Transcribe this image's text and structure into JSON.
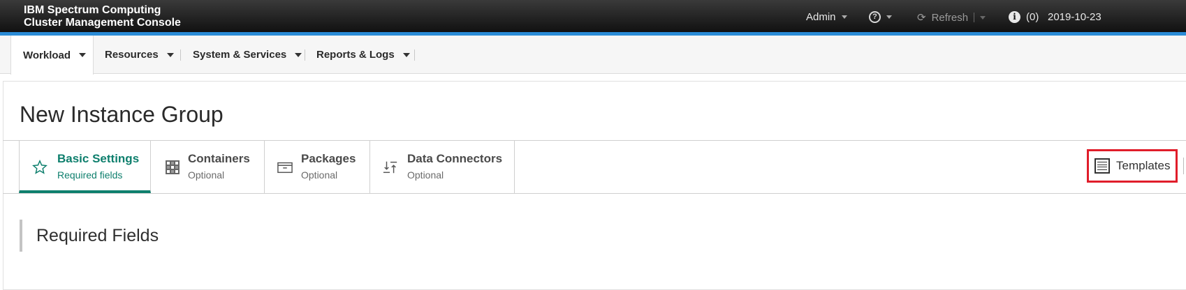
{
  "header": {
    "brand_line1": "IBM Spectrum Computing",
    "brand_line2": "Cluster Management Console",
    "user": "Admin",
    "help_icon": "question-circle-icon",
    "refresh": "Refresh",
    "info_count": "(0)",
    "datetime": "2019-10-23"
  },
  "nav": {
    "items": [
      {
        "label": "Workload"
      },
      {
        "label": "Resources"
      },
      {
        "label": "System & Services"
      },
      {
        "label": "Reports & Logs"
      }
    ]
  },
  "page": {
    "title": "New Instance Group"
  },
  "tabs": [
    {
      "label": "Basic Settings",
      "sub": "Required fields",
      "icon": "star-icon"
    },
    {
      "label": "Containers",
      "sub": "Optional",
      "icon": "containers-icon"
    },
    {
      "label": "Packages",
      "sub": "Optional",
      "icon": "package-icon"
    },
    {
      "label": "Data Connectors",
      "sub": "Optional",
      "icon": "data-connectors-icon"
    }
  ],
  "templates": {
    "label": "Templates",
    "icon": "document-icon"
  },
  "section": {
    "title": "Required Fields"
  },
  "colors": {
    "accent": "#0e7f6d",
    "topbar_stripe": "#2a8bd6",
    "highlight_box": "#e01d2a"
  }
}
